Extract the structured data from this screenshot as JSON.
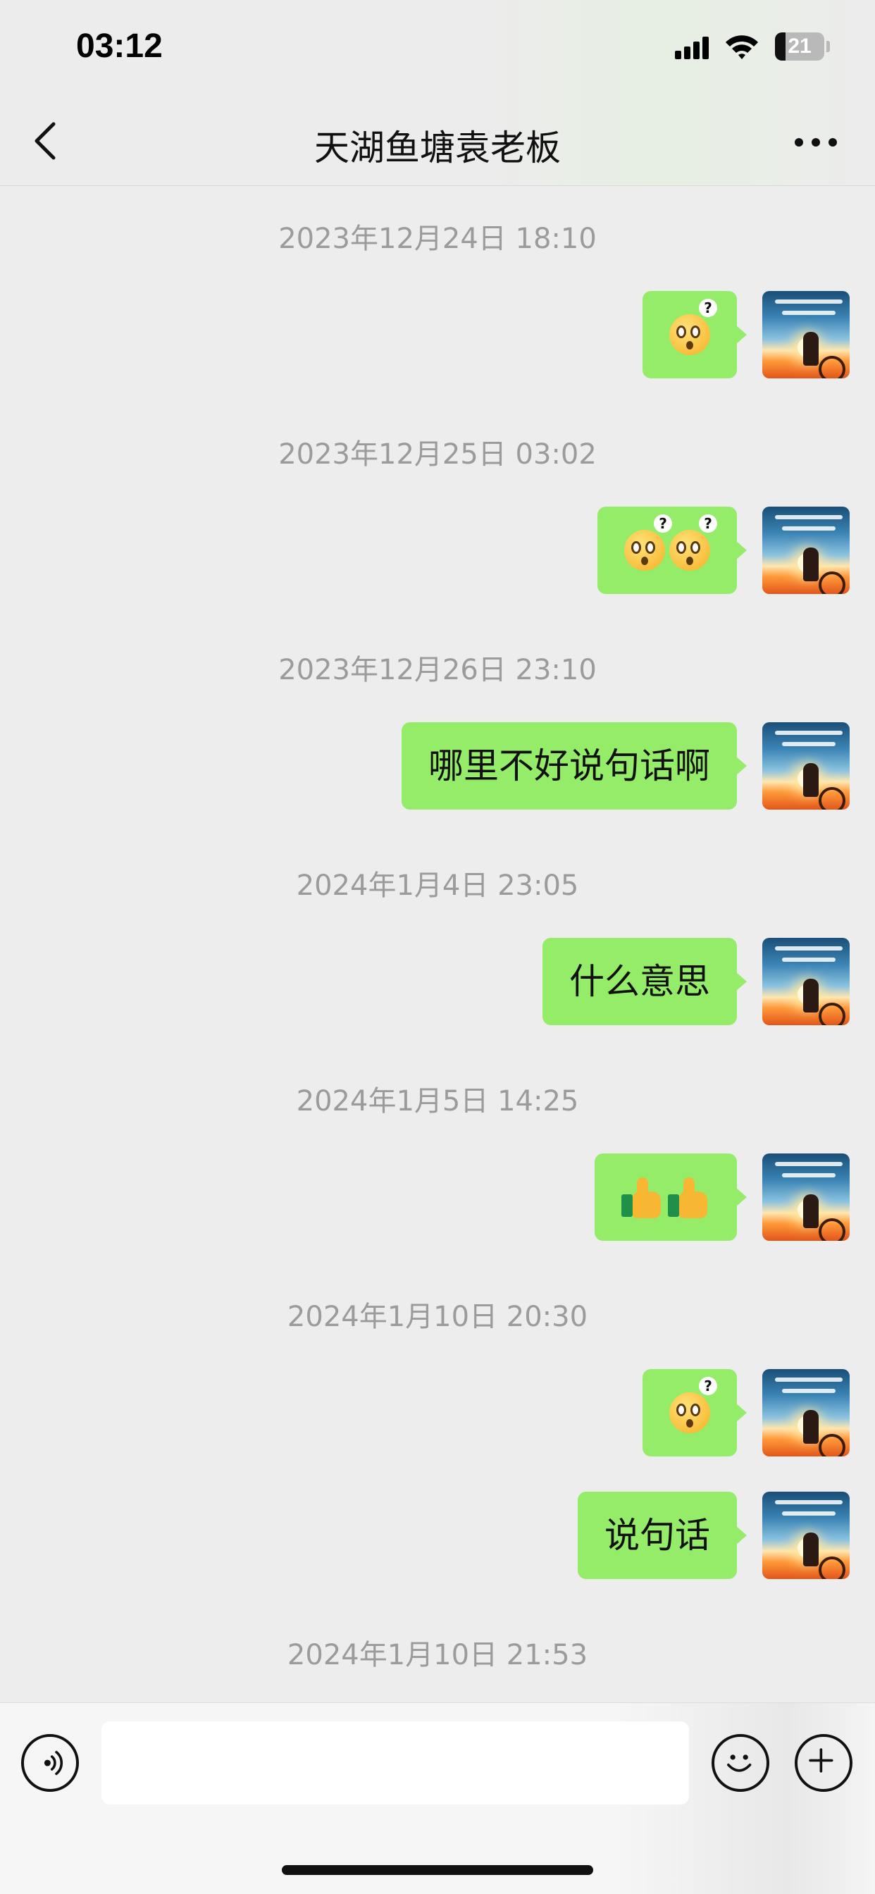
{
  "status_bar": {
    "time": "03:12",
    "battery_level": "21",
    "battery_fraction": 0.21
  },
  "header": {
    "title": "天湖鱼塘袁老板",
    "back_icon": "chevron-left-icon",
    "more_icon": "more-dots-icon"
  },
  "messages": [
    {
      "timestamp": "2023年12月24日 18:10",
      "content": [
        {
          "type": "emoji",
          "name": "thinking-question-emoji"
        }
      ]
    },
    {
      "timestamp": "2023年12月25日 03:02",
      "content": [
        {
          "type": "emoji",
          "name": "thinking-question-emoji"
        },
        {
          "type": "emoji",
          "name": "thinking-question-emoji"
        }
      ]
    },
    {
      "timestamp": "2023年12月26日 23:10",
      "text": "哪里不好说句话啊"
    },
    {
      "timestamp": "2024年1月4日 23:05",
      "text": "什么意思"
    },
    {
      "timestamp": "2024年1月5日 14:25",
      "content": [
        {
          "type": "emoji",
          "name": "thumbs-up-emoji"
        },
        {
          "type": "emoji",
          "name": "thumbs-up-emoji"
        }
      ]
    },
    {
      "timestamp": "2024年1月10日 20:30",
      "content": [
        {
          "type": "emoji",
          "name": "thinking-question-emoji"
        }
      ]
    },
    {
      "text": "说句话"
    },
    {
      "timestamp": "2024年1月10日 21:53"
    }
  ],
  "input_bar": {
    "voice_icon": "voice-icon",
    "emoji_icon": "smiley-icon",
    "plus_icon": "plus-icon",
    "input_value": ""
  },
  "colors": {
    "bubble": "#95ec69",
    "background": "#ededed",
    "timestamp": "#9b9b9b"
  }
}
